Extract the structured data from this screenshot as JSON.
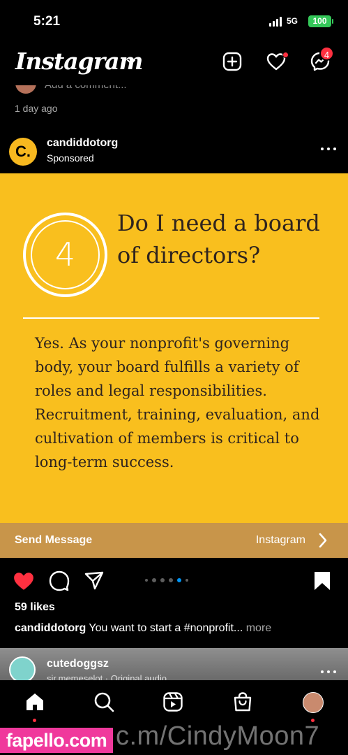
{
  "status_bar": {
    "time": "5:21",
    "network": "5G",
    "battery": "100"
  },
  "top_nav": {
    "logo": "Instagram",
    "messenger_badge": "4"
  },
  "previous_post": {
    "comment_placeholder": "Add a comment...",
    "time_ago": "1 day ago"
  },
  "post": {
    "username": "candiddotorg",
    "sponsored_label": "Sponsored",
    "avatar_letter": "C.",
    "ad": {
      "number": "4",
      "question": "Do I need a board of directors?",
      "answer": "Yes. As your nonprofit's governing body, your board fulfills a variety of roles and legal responsibilities. Recruitment, training, evaluation, and cultivation of members is critical to long-term success."
    },
    "cta": {
      "left_label": "Send Message",
      "right_label": "Instagram"
    },
    "likes": "59 likes",
    "caption_user": "candiddotorg",
    "caption_text": "You want to start a #nonprofit...",
    "caption_more": "more"
  },
  "next_post": {
    "username": "cutedoggsz",
    "subtitle": "sir.memeselot · Original audio"
  },
  "watermark": {
    "site": "fapello.com",
    "handle": "c.m/CindyMoon7"
  },
  "colors": {
    "ad_yellow": "#f9bf1e",
    "cta_brown": "#c8954a",
    "like_red": "#ff3040",
    "accent_blue": "#0095f6"
  },
  "icons": [
    "chevron-down-icon",
    "new-post-icon",
    "heart-icon",
    "messenger-icon",
    "more-icon",
    "chevron-right-icon",
    "comment-icon",
    "share-icon",
    "bookmark-icon",
    "home-icon",
    "search-icon",
    "reels-icon",
    "shop-icon"
  ]
}
